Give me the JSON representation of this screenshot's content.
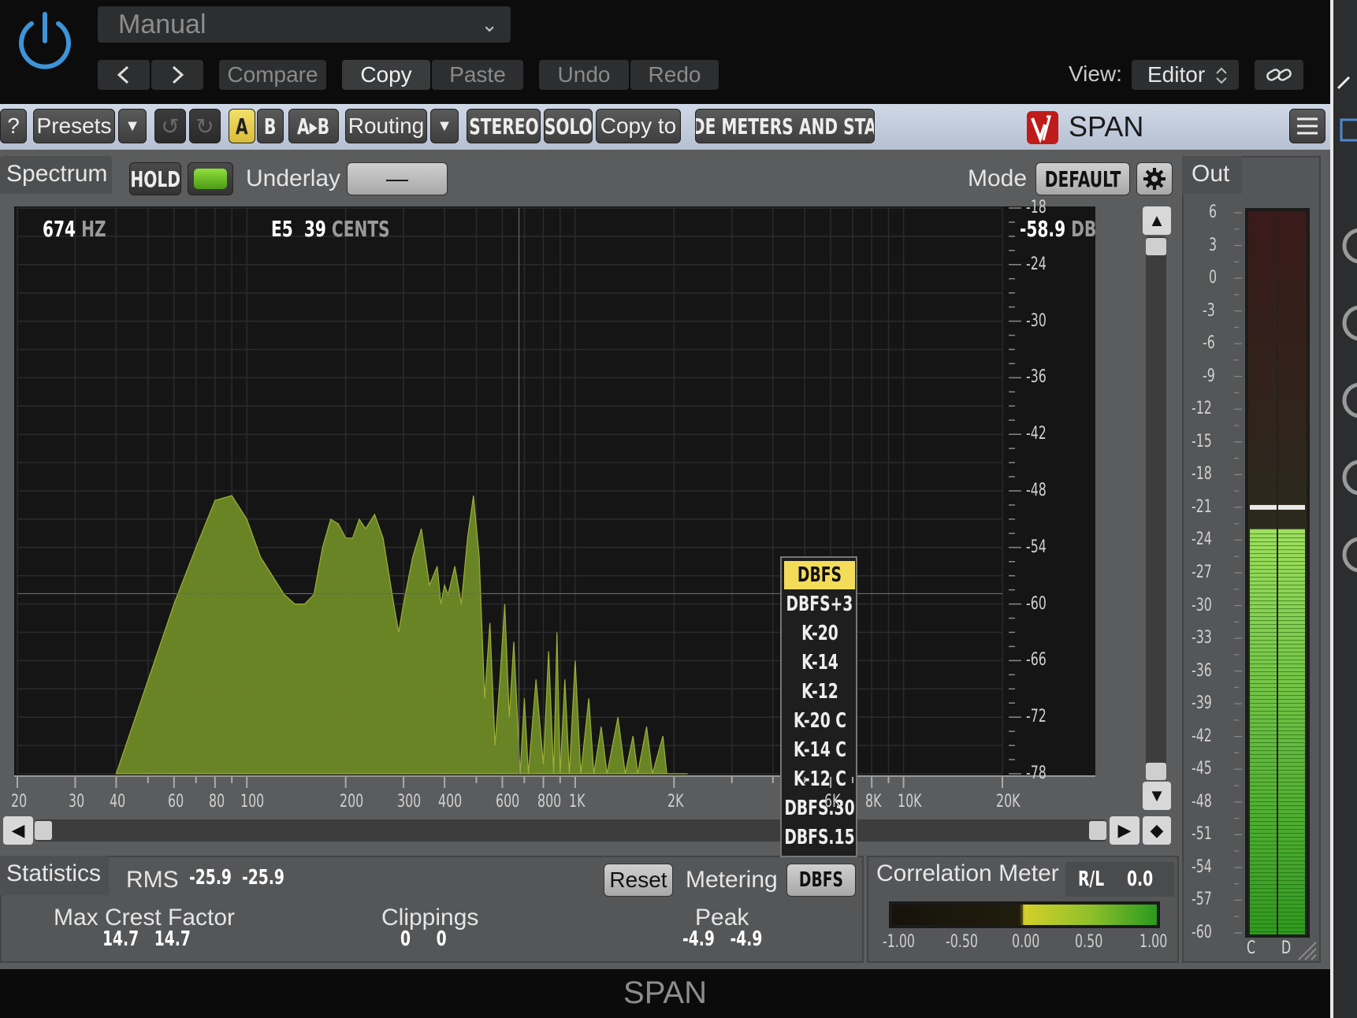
{
  "host": {
    "preset": "Manual",
    "compare_label": "Compare",
    "copy_label": "Copy",
    "paste_label": "Paste",
    "undo_label": "Undo",
    "redo_label": "Redo",
    "view_label": "View:",
    "view_value": "Editor",
    "footer_title": "SPAN"
  },
  "toolbar": {
    "help": "?",
    "presets": "Presets",
    "a": "A",
    "b": "B",
    "ab": "A▸B",
    "routing": "Routing",
    "stereo": "STEREO",
    "solo": "SOLO",
    "copy_to": "Copy to",
    "hide_meters": "HIDE METERS AND STATS",
    "brand": "SPAN"
  },
  "spectrum": {
    "title": "Spectrum",
    "hold": "HOLD",
    "underlay_label": "Underlay",
    "underlay_value": "—",
    "mode_label": "Mode",
    "mode_value": "DEFAULT",
    "readout_hz_value": "674",
    "readout_hz_unit": "HZ",
    "readout_note": "E5",
    "readout_cents_value": "39",
    "readout_cents_unit": "CENTS",
    "readout_db_value": "-58.9",
    "readout_db_unit": "DB",
    "x_ticks": [
      "20",
      "30",
      "40",
      "60",
      "80",
      "100",
      "200",
      "300",
      "400",
      "600",
      "800",
      "1K",
      "2K",
      "6K",
      "8K",
      "10K",
      "20K"
    ],
    "x_tick_hz": [
      20,
      30,
      40,
      60,
      80,
      100,
      200,
      300,
      400,
      600,
      800,
      1000,
      2000,
      6000,
      8000,
      10000,
      20000
    ],
    "y_ticks": [
      "-18",
      "-24",
      "-30",
      "-36",
      "-42",
      "-48",
      "-54",
      "-60",
      "-66",
      "-72",
      "-78"
    ],
    "cursor_hz": 674,
    "cursor_db": -58.9,
    "fill_color": "#6e8a26",
    "curve_db": [
      [
        40,
        -78
      ],
      [
        60,
        -60
      ],
      [
        70,
        -54
      ],
      [
        80,
        -49
      ],
      [
        90,
        -48.5
      ],
      [
        100,
        -51
      ],
      [
        110,
        -55
      ],
      [
        130,
        -59
      ],
      [
        140,
        -60
      ],
      [
        150,
        -60
      ],
      [
        160,
        -59
      ],
      [
        170,
        -54
      ],
      [
        180,
        -51
      ],
      [
        190,
        -51.5
      ],
      [
        200,
        -53
      ],
      [
        210,
        -53
      ],
      [
        220,
        -51
      ],
      [
        230,
        -52
      ],
      [
        245,
        -50.5
      ],
      [
        260,
        -53
      ],
      [
        280,
        -60
      ],
      [
        290,
        -63
      ],
      [
        300,
        -60
      ],
      [
        320,
        -55
      ],
      [
        340,
        -52
      ],
      [
        360,
        -58
      ],
      [
        380,
        -56
      ],
      [
        390,
        -60
      ],
      [
        400,
        -58
      ],
      [
        410,
        -59
      ],
      [
        430,
        -56
      ],
      [
        450,
        -60
      ],
      [
        470,
        -53
      ],
      [
        490,
        -48.5
      ],
      [
        510,
        -55
      ],
      [
        530,
        -70
      ],
      [
        550,
        -62
      ],
      [
        570,
        -75
      ],
      [
        590,
        -68
      ],
      [
        610,
        -60
      ],
      [
        630,
        -72
      ],
      [
        650,
        -64
      ],
      [
        680,
        -78
      ],
      [
        700,
        -70
      ],
      [
        720,
        -78
      ],
      [
        760,
        -68
      ],
      [
        800,
        -77
      ],
      [
        830,
        -65
      ],
      [
        860,
        -78
      ],
      [
        880,
        -63
      ],
      [
        900,
        -78
      ],
      [
        930,
        -68
      ],
      [
        960,
        -78
      ],
      [
        1000,
        -66
      ],
      [
        1040,
        -78
      ],
      [
        1100,
        -70
      ],
      [
        1140,
        -78
      ],
      [
        1200,
        -73
      ],
      [
        1250,
        -78
      ],
      [
        1350,
        -72
      ],
      [
        1420,
        -78
      ],
      [
        1500,
        -74
      ],
      [
        1550,
        -78
      ],
      [
        1650,
        -73
      ],
      [
        1720,
        -78
      ],
      [
        1850,
        -74
      ],
      [
        1900,
        -78
      ],
      [
        2200,
        -78
      ]
    ]
  },
  "metering_menu": {
    "items": [
      "DBFS",
      "DBFS+3",
      "K-20",
      "K-14",
      "K-12",
      "K-20 C",
      "K-14 C",
      "K-12 C",
      "DBFS.30",
      "DBFS.15"
    ],
    "selected": "DBFS"
  },
  "statistics": {
    "title": "Statistics",
    "rms_label": "RMS",
    "rms_l": "-25.9",
    "rms_r": "-25.9",
    "reset": "Reset",
    "metering_label": "Metering",
    "metering_value": "DBFS",
    "crest_label": "Max Crest Factor",
    "crest_l": "14.7",
    "crest_r": "14.7",
    "clip_label": "Clippings",
    "clip_l": "0",
    "clip_r": "0",
    "peak_label": "Peak",
    "peak_l": "-4.9",
    "peak_r": "-4.9"
  },
  "correlation": {
    "title": "Correlation Meter",
    "rl_label": "R/L",
    "rl_value": "0.0",
    "scale": [
      "-1.00",
      "-0.50",
      "0.00",
      "0.50",
      "1.00"
    ]
  },
  "out_meter": {
    "title": "Out",
    "scale": [
      "6",
      "3",
      "0",
      "-3",
      "-6",
      "-9",
      "-12",
      "-15",
      "-18",
      "-21",
      "-24",
      "-27",
      "-30",
      "-33",
      "-36",
      "-39",
      "-42",
      "-45",
      "-48",
      "-51",
      "-54",
      "-57",
      "-60"
    ],
    "level_db": -23,
    "peak_db": -21,
    "channel_l": "C",
    "channel_r": "D"
  }
}
